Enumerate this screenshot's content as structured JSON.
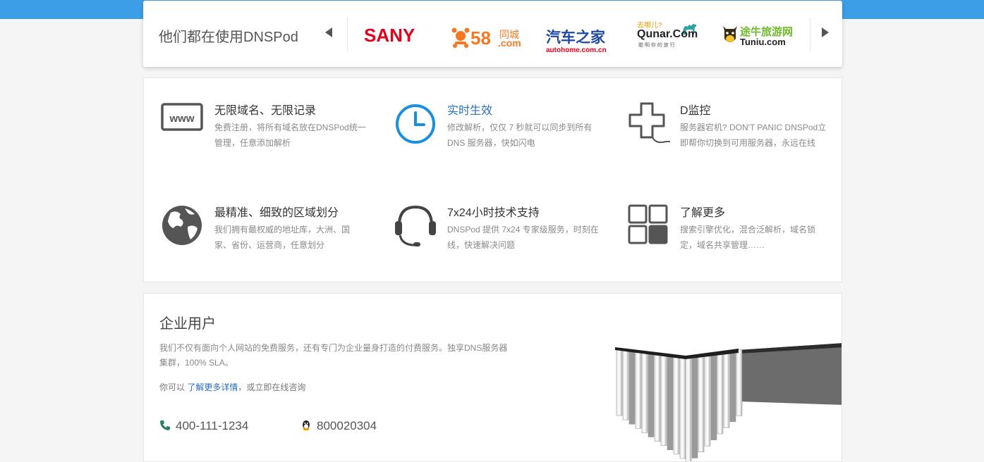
{
  "partners": {
    "title": "他们都在使用DNSPod",
    "logos": [
      {
        "name": "sany",
        "line1": "SANY",
        "color": "#e4001c"
      },
      {
        "name": "58",
        "line1": "58",
        "line1b": ".com",
        "line2": "同城",
        "color": "#f47920"
      },
      {
        "name": "autohome",
        "line1": "汽车之家",
        "line2": "autohome.com.cn",
        "color": "#1f4aa3",
        "color2": "#e4001c"
      },
      {
        "name": "qunar",
        "line1": "Qunar.Com",
        "line0": "去哪儿?",
        "line2": "聪 明 你 的 旅 行",
        "color": "#222",
        "color2": "#2aa6a0"
      },
      {
        "name": "tuniu",
        "line1": "途牛旅游网",
        "line2": "Tuniu.com",
        "color": "#6fba2c"
      }
    ]
  },
  "features": [
    {
      "title": "无限域名、无限记录",
      "desc": "免费注册，将所有域名放在DNSPod统一管理，任意添加解析",
      "icon": "www-icon",
      "highlight": false
    },
    {
      "title": "实时生效",
      "desc": "修改解析，仅仅 7 秒就可以同步到所有 DNS 服务器，快如闪电",
      "icon": "clock-icon",
      "highlight": true
    },
    {
      "title": "D监控",
      "desc": "服务器宕机? DON'T PANIC DNSPod立即帮你切换到可用服务器，永远在线",
      "icon": "monitor-cross-icon",
      "highlight": false
    },
    {
      "title": "最精准、细致的区域划分",
      "desc": "我们拥有最权威的地址库，大洲、国家、省份、运营商，任意划分",
      "icon": "globe-icon",
      "highlight": false
    },
    {
      "title": "7x24小时技术支持",
      "desc": "DNSPod 提供 7x24 专家级服务，时刻在线，快速解决问题",
      "icon": "headset-icon",
      "highlight": false
    },
    {
      "title": "了解更多",
      "desc": "搜索引擎优化，混合泛解析，域名锁定，域名共享管理……",
      "icon": "grid-icon",
      "highlight": false
    }
  ],
  "enterprise": {
    "title": "企业用户",
    "desc": "我们不仅有面向个人网站的免费服务，还有专门为企业量身打造的付费服务。独享DNS服务器集群，100% SLA。",
    "more_prefix": "你可以",
    "more_link": "了解更多详情",
    "more_suffix": "，或立即在线咨询",
    "phone": "400-111-1234",
    "qq": "800020304"
  },
  "colors": {
    "topbar": "#3d9ee8",
    "accent": "#2c6fbf",
    "clock": "#1a8fe0"
  }
}
